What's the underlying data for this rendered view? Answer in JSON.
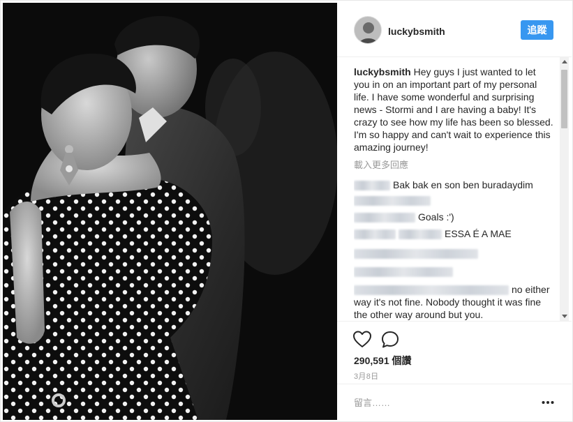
{
  "post": {
    "username": "luckybsmith",
    "follow_label": "追蹤",
    "caption_username": "luckybsmith",
    "caption_text": "Hey guys I just wanted to let you in on an important part of my personal life. I have some wonderful and surprising news - Stormi and I are having a baby! It's crazy to see how my life has been so blessed. I'm so happy and can't wait to experience this amazing journey!",
    "load_more": "載入更多回應",
    "comments": [
      {
        "text": "Bak bak en son ben buradaydim"
      },
      {
        "text": "Goals :')"
      },
      {
        "text": "ESSA É A MAE"
      },
      {
        "text": ""
      },
      {
        "text": ""
      },
      {
        "text": "no either way it's not fine. Nobody thought it was fine the other way around but you."
      }
    ],
    "views": "290,591 個讚",
    "date": "3月8日",
    "comment_placeholder": "留言……"
  },
  "icons": {
    "like": "heart-icon",
    "comment": "comment-bubble-icon",
    "more": "more-options-icon"
  },
  "colors": {
    "follow_button": "#3897f0",
    "muted_text": "#999999",
    "primary_text": "#262626"
  }
}
